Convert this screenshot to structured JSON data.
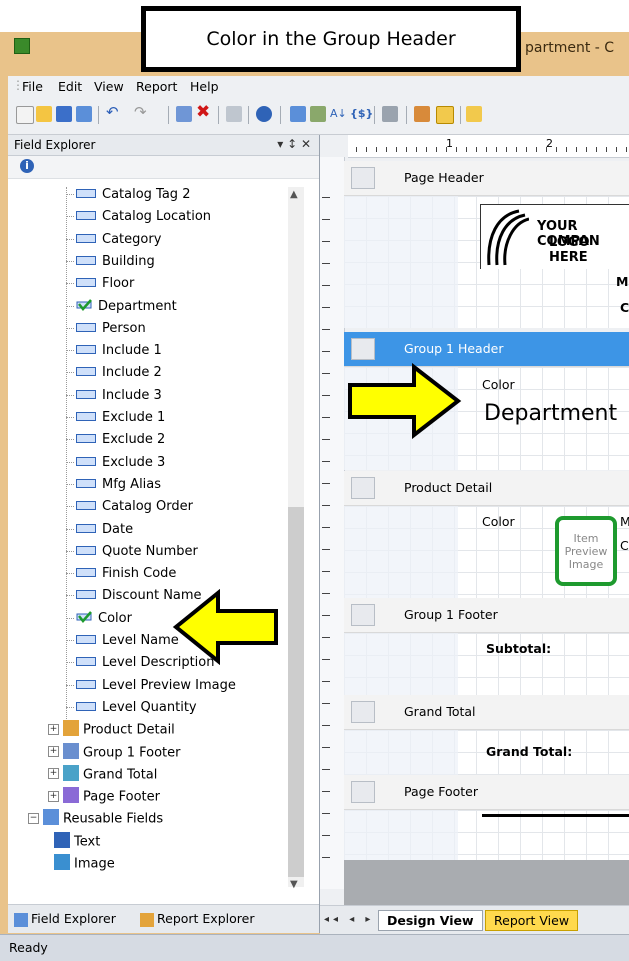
{
  "callout": {
    "text": "Color in the Group Header"
  },
  "window": {
    "title_fragment": "partment - C"
  },
  "menu": [
    "File",
    "Edit",
    "View",
    "Report",
    "Help"
  ],
  "field_explorer": {
    "title": "Field Explorer",
    "header_controls": "▾ ↕ ✕",
    "items": [
      {
        "label": "Catalog Tag 2",
        "type": "field"
      },
      {
        "label": "Catalog Location",
        "type": "field"
      },
      {
        "label": "Category",
        "type": "field"
      },
      {
        "label": "Building",
        "type": "field"
      },
      {
        "label": "Floor",
        "type": "field"
      },
      {
        "label": "Department",
        "type": "checked"
      },
      {
        "label": "Person",
        "type": "field"
      },
      {
        "label": "Include 1",
        "type": "field"
      },
      {
        "label": "Include 2",
        "type": "field"
      },
      {
        "label": "Include 3",
        "type": "field"
      },
      {
        "label": "Exclude 1",
        "type": "field"
      },
      {
        "label": "Exclude 2",
        "type": "field"
      },
      {
        "label": "Exclude 3",
        "type": "field"
      },
      {
        "label": "Mfg Alias",
        "type": "field"
      },
      {
        "label": "Catalog Order",
        "type": "field"
      },
      {
        "label": "Date",
        "type": "field"
      },
      {
        "label": "Quote Number",
        "type": "field"
      },
      {
        "label": "Finish Code",
        "type": "field"
      },
      {
        "label": "Discount Name",
        "type": "field"
      },
      {
        "label": "Color",
        "type": "checked"
      },
      {
        "label": "Level Name",
        "type": "field"
      },
      {
        "label": "Level Description",
        "type": "field"
      },
      {
        "label": "Level Preview Image",
        "type": "field"
      },
      {
        "label": "Level Quantity",
        "type": "field"
      }
    ],
    "groups": [
      {
        "label": "Product Detail"
      },
      {
        "label": "Group 1 Footer"
      },
      {
        "label": "Grand Total"
      },
      {
        "label": "Page Footer"
      }
    ],
    "reusable": {
      "label": "Reusable Fields",
      "children": [
        "Text",
        "Image"
      ]
    },
    "tabs": [
      "Field Explorer",
      "Report Explorer"
    ]
  },
  "designer": {
    "ruler_marks": [
      "1",
      "2"
    ],
    "bands": [
      {
        "label": "Page Header"
      },
      {
        "label": "Group 1 Header"
      },
      {
        "label": "Product Detail"
      },
      {
        "label": "Group 1 Footer"
      },
      {
        "label": "Grand Total"
      },
      {
        "label": "Page Footer"
      }
    ],
    "logo_line1": "YOUR COMPAN",
    "logo_line2": "LOGO HERE",
    "group_color_field": "Color",
    "group_department_field": "Department",
    "detail_color_field": "Color",
    "item_preview": "Item Preview Image",
    "subtotal": "Subtotal:",
    "grand_total": "Grand Total:",
    "partial_m": "M",
    "partial_c": "C",
    "partial_ca": "Ca",
    "view_tabs": [
      "Design View",
      "Report View"
    ]
  },
  "status": "Ready"
}
